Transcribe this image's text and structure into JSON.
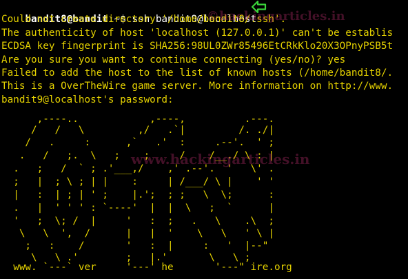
{
  "terminal": {
    "prompt": {
      "user_host": "bandit8@bandit",
      "path_suffix": ":~$ ",
      "command": "ssh bandit9@localhost"
    },
    "output": [
      "Could not create directory '/home/bandit8/.ssh'.",
      "The authenticity of host 'localhost (127.0.0.1)' can't be establis",
      "ECDSA key fingerprint is SHA256:98UL0ZWr85496EtCRkKlo20X3OPnyPSB5t",
      "Are you sure you want to continue connecting (yes/no)? yes",
      "Failed to add the host to the list of known hosts (/home/bandit8/.",
      "This is a OverTheWire game server. More information on http://www.",
      "bandit9@localhost's password:"
    ],
    "banner": [
      "",
      "      ,----..            ,----,          .---.",
      "     /   /   \\         ,/   .`|         /. ./|",
      "    /   .     :      ,`   .'  :     .--'.  ' ;",
      "   .   /   ;.  \\   ;    ;     /    /__./ \\ : |",
      "  .   ;   /  ` ; .'___,/    ,' .--'.  '   \\' .",
      "  ;   |  ; \\ ; | |    :     | /___/ \\ |    ' '",
      "  |   :  | ; | ' ;    |.';  ; ;   \\  \\;      :",
      "  .   |  ' ' ' : `----'  |  |  \\   ;  `      |",
      "  '   ;  \\; /  |     '   :  ;   .   \\    .\\  ;",
      "   \\   \\  ',  /      |   |  '    \\   \\   ' \\ |",
      "    ;   :    /       '   :  |     :   '  |--\"",
      "     \\   \\ .'        ;   |.'       \\   \\ ;",
      "  www. `---` ver     '---' he       '---\" ire.org"
    ],
    "watermarks": [
      "©hackingarticles.in",
      "www.hackingarticles.in"
    ],
    "colors": {
      "background": "#000000",
      "text": "#e5d200",
      "prompt": "#ffffff",
      "arrow": "#3bd43b"
    },
    "arrow_icon": "left-arrow-icon"
  }
}
